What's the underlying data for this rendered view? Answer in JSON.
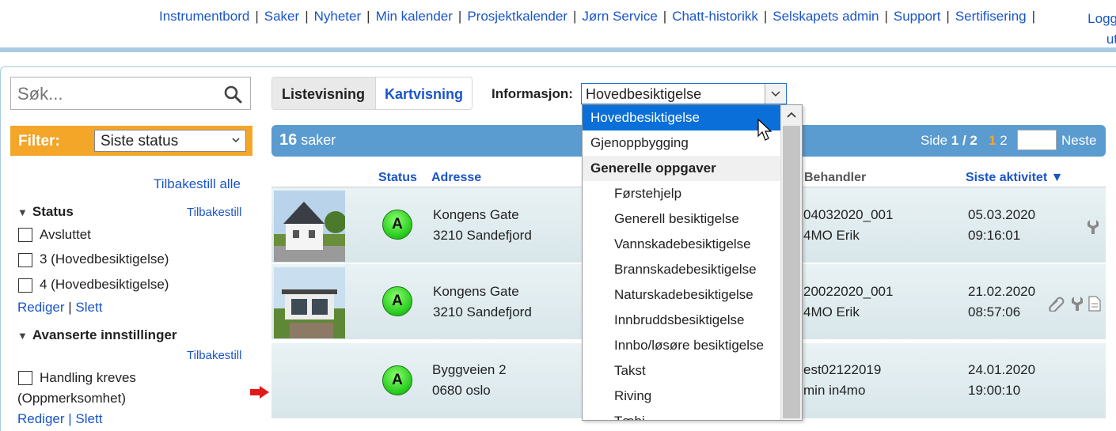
{
  "nav": {
    "items": [
      "Instrumentbord",
      "Saker",
      "Nyheter",
      "Min kalender",
      "Prosjektkalender",
      "Jørn Service",
      "Chatt-historikk",
      "Selskapets admin",
      "Support",
      "Sertifisering"
    ],
    "logout_line1": "Logg",
    "logout_line2": "ut"
  },
  "sidebar": {
    "search_placeholder": "Søk...",
    "filter_label": "Filter:",
    "filter_value": "Siste status",
    "reset_all": "Tilbakestill alle",
    "status_heading": "Status",
    "reset": "Tilbakestill",
    "status_options": [
      "Avsluttet",
      "3 (Hovedbesiktigelse)",
      "4 (Hovedbesiktigelse)"
    ],
    "edit": "Rediger",
    "delete": "Slett",
    "advanced_heading": "Avanserte innstillinger",
    "advanced_reset": "Tilbakestill",
    "advanced_option_line1": "Handling kreves",
    "advanced_option_line2": "(Oppmerksomhet)",
    "advanced_edit": "Rediger | Slett"
  },
  "toolbar": {
    "tab_list": "Listevisning",
    "tab_map": "Kartvisning",
    "info_label": "Informasjon:",
    "info_value": "Hovedbesiktigelse"
  },
  "casebar": {
    "count": "16",
    "count_label": "saker",
    "page_prefix": "Side",
    "page_current": "1 / 2",
    "page_link_1": "1",
    "page_link_2": "2",
    "next": "Neste"
  },
  "table": {
    "headers": {
      "status": "Status",
      "address": "Adresse",
      "handler": "Behandler",
      "activity": "Siste aktivitet ▼"
    },
    "rows": [
      {
        "status": "A",
        "street": "Kongens Gate",
        "city": "3210 Sandefjord",
        "case": "04032020_001",
        "handler": "4MO Erik",
        "date": "05.03.2020",
        "time": "09:16:01"
      },
      {
        "status": "A",
        "street": "Kongens Gate",
        "city": "3210 Sandefjord",
        "case": "20022020_001",
        "handler": "4MO Erik",
        "date": "21.02.2020",
        "time": "08:57:06"
      },
      {
        "status": "A",
        "street": "Byggveien 2",
        "city": "0680 oslo",
        "case": "est02122019",
        "handler": "min in4mo",
        "date": "24.01.2020",
        "time": "19:00:10"
      }
    ]
  },
  "dropdown": {
    "options": [
      {
        "label": "Hovedbesiktigelse",
        "selected": true
      },
      {
        "label": "Gjenoppbygging"
      },
      {
        "label": "Generelle oppgaver",
        "group": true
      },
      {
        "label": "Førstehjelp",
        "indent": true
      },
      {
        "label": "Generell besiktigelse",
        "indent": true
      },
      {
        "label": "Vannskadebesiktigelse",
        "indent": true
      },
      {
        "label": "Brannskadebesiktigelse",
        "indent": true
      },
      {
        "label": "Naturskadebesiktigelse",
        "indent": true
      },
      {
        "label": "Innbruddsbesiktigelse",
        "indent": true
      },
      {
        "label": "Innbo/løsøre besiktigelse",
        "indent": true
      },
      {
        "label": "Takst",
        "indent": true
      },
      {
        "label": "Riving",
        "indent": true
      },
      {
        "label": "Tæbi",
        "indent": true
      }
    ]
  },
  "colors": {
    "link": "#1a55c8",
    "accent": "#f3a628",
    "bar": "#5a9bd0",
    "selected": "#0a6fd8"
  }
}
